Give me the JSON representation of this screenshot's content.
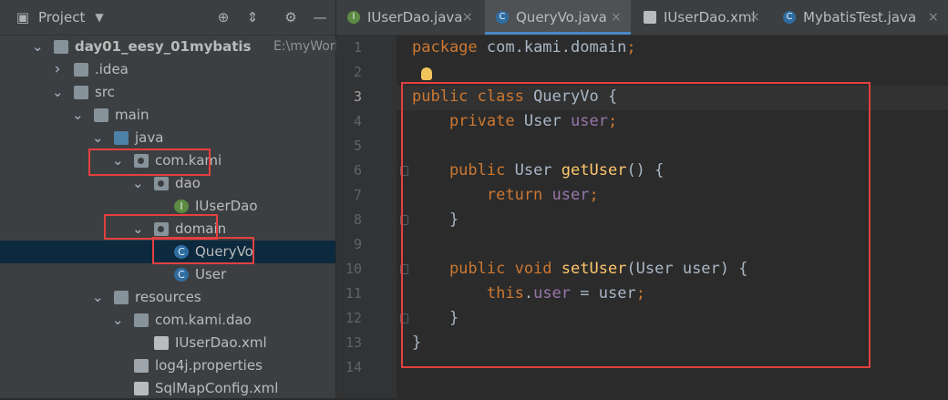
{
  "project_panel": {
    "title": "Project",
    "tree": [
      {
        "label": "day01_eesy_01mybatis",
        "hint": "E:\\myWork\\Works",
        "depth": 0,
        "icon": "module-folder",
        "arrow": "down"
      },
      {
        "label": ".idea",
        "depth": 1,
        "icon": "folder",
        "arrow": "right"
      },
      {
        "label": "src",
        "depth": 1,
        "icon": "folder",
        "arrow": "down"
      },
      {
        "label": "main",
        "depth": 2,
        "icon": "folder",
        "arrow": "down"
      },
      {
        "label": "java",
        "depth": 3,
        "icon": "source-folder",
        "arrow": "down"
      },
      {
        "label": "com.kami",
        "depth": 4,
        "icon": "package",
        "arrow": "down"
      },
      {
        "label": "dao",
        "depth": 5,
        "icon": "package",
        "arrow": "down"
      },
      {
        "label": "IUserDao",
        "depth": 6,
        "icon": "interface"
      },
      {
        "label": "domain",
        "depth": 5,
        "icon": "package",
        "arrow": "down"
      },
      {
        "label": "QueryVo",
        "depth": 6,
        "icon": "class",
        "selected": true
      },
      {
        "label": "User",
        "depth": 6,
        "icon": "class"
      },
      {
        "label": "resources",
        "depth": 3,
        "icon": "resources-folder",
        "arrow": "down"
      },
      {
        "label": "com.kami.dao",
        "depth": 4,
        "icon": "folder",
        "arrow": "down"
      },
      {
        "label": "IUserDao.xml",
        "depth": 5,
        "icon": "xml-file"
      },
      {
        "label": "log4j.properties",
        "depth": 4,
        "icon": "properties-file"
      },
      {
        "label": "SqlMapConfig.xml",
        "depth": 4,
        "icon": "xml-file"
      }
    ]
  },
  "tabs": [
    {
      "label": "IUserDao.java",
      "icon": "interface",
      "active": false
    },
    {
      "label": "QueryVo.java",
      "icon": "class",
      "active": true
    },
    {
      "label": "IUserDao.xml",
      "icon": "xml-file",
      "active": false
    },
    {
      "label": "MybatisTest.java",
      "icon": "test-class",
      "active": false
    }
  ],
  "editor": {
    "current_line": 3,
    "lines": [
      [
        {
          "t": "package",
          "c": "kw"
        },
        {
          "t": " com.kami.domain"
        },
        {
          "t": ";",
          "c": "kw"
        }
      ],
      [],
      [
        {
          "t": "public class ",
          "c": "kw"
        },
        {
          "t": "QueryVo {"
        }
      ],
      [
        {
          "t": "    private ",
          "c": "kw"
        },
        {
          "t": "User "
        },
        {
          "t": "user",
          "c": "fld"
        },
        {
          "t": ";",
          "c": "kw"
        }
      ],
      [],
      [
        {
          "t": "    public ",
          "c": "kw"
        },
        {
          "t": "User "
        },
        {
          "t": "getUser",
          "c": "mth"
        },
        {
          "t": "() {"
        }
      ],
      [
        {
          "t": "        return ",
          "c": "kw"
        },
        {
          "t": "user",
          "c": "fld"
        },
        {
          "t": ";",
          "c": "kw"
        }
      ],
      [
        {
          "t": "    }"
        }
      ],
      [],
      [
        {
          "t": "    public void ",
          "c": "kw"
        },
        {
          "t": "setUser",
          "c": "mth"
        },
        {
          "t": "(User user) {"
        }
      ],
      [
        {
          "t": "        this",
          "c": "kw"
        },
        {
          "t": "."
        },
        {
          "t": "user",
          "c": "fld"
        },
        {
          "t": " = user"
        },
        {
          "t": ";",
          "c": "kw"
        }
      ],
      [
        {
          "t": "    }"
        }
      ],
      [
        {
          "t": "}"
        }
      ],
      []
    ]
  },
  "colors": {
    "highlight_box": "#e34040",
    "keyword": "#cc7832",
    "field": "#9876aa",
    "method": "#ffc66d"
  }
}
